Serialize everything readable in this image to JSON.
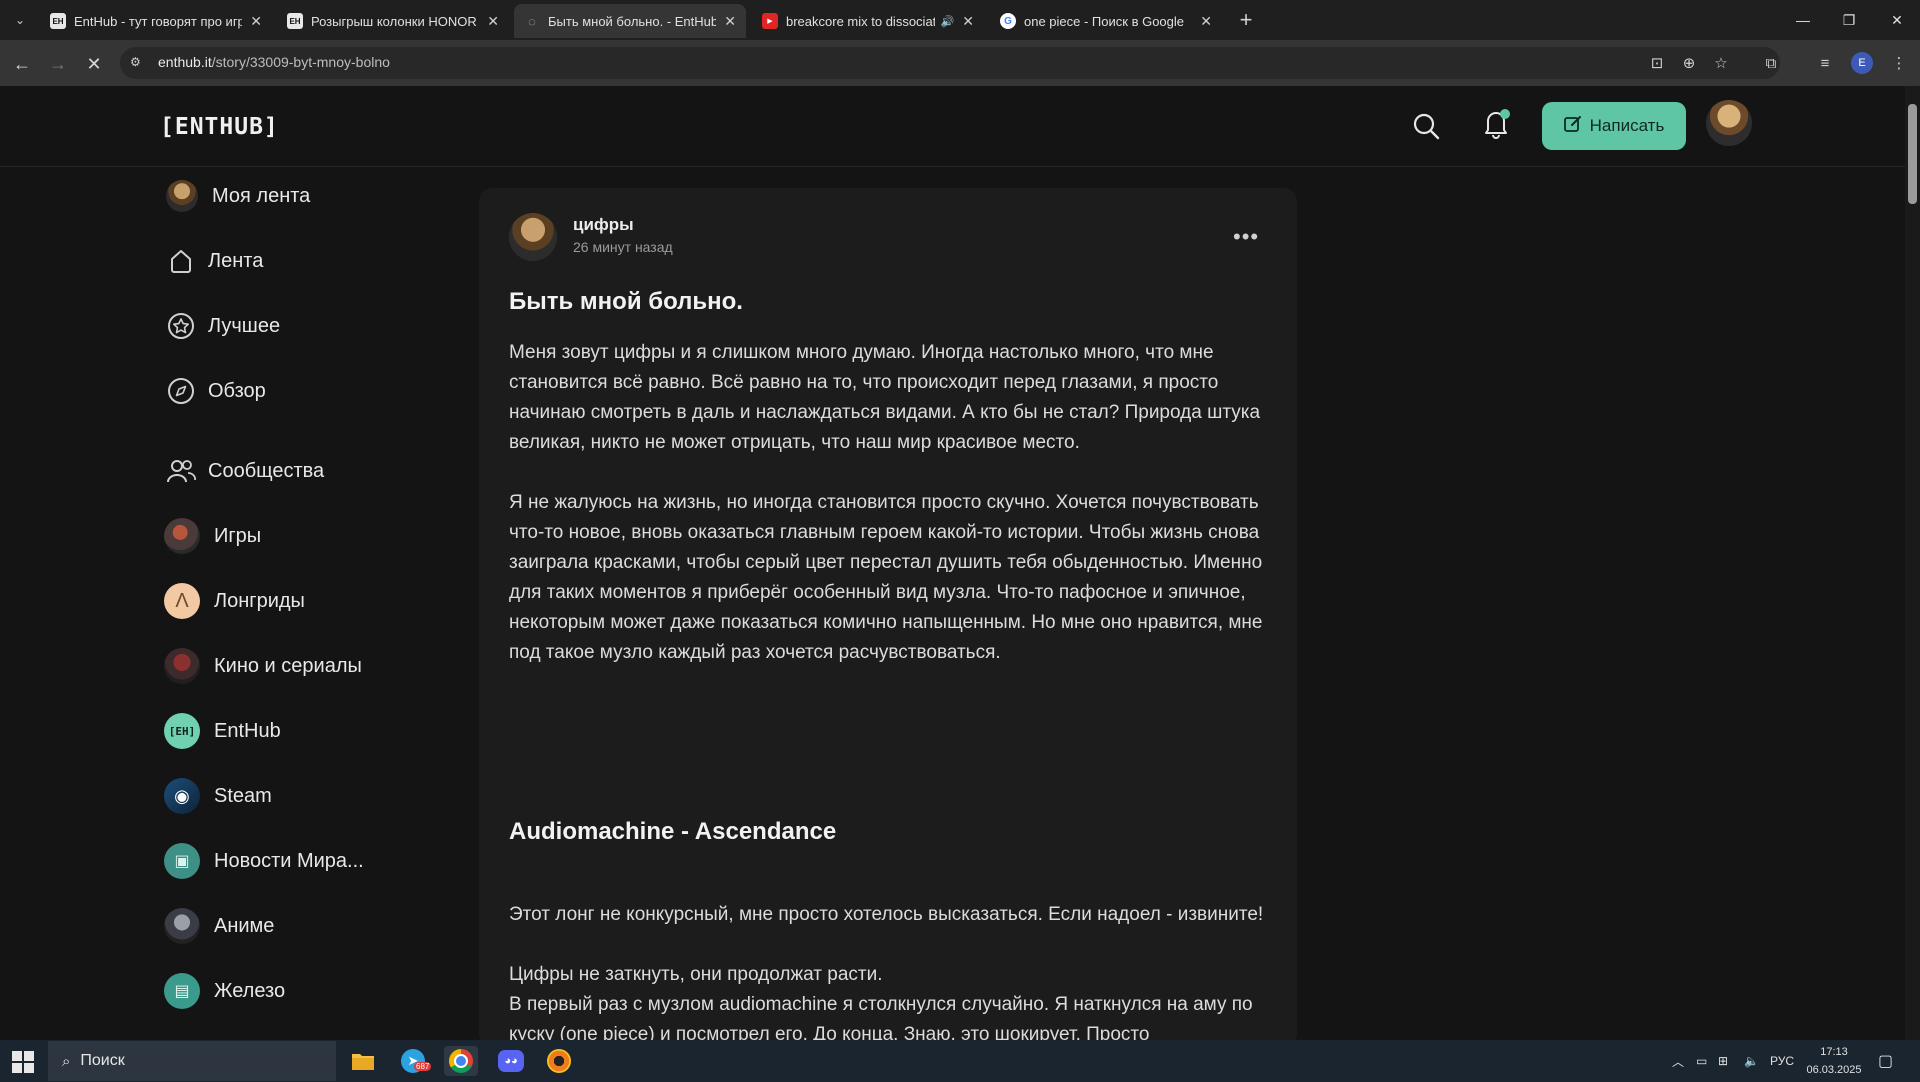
{
  "browser": {
    "tabs": [
      {
        "title": "EntHub - тут говорят про игры",
        "active": false
      },
      {
        "title": "Розыгрыш колонки HONOR от",
        "active": false
      },
      {
        "title": "Быть мной больно. - EntHub",
        "active": true
      },
      {
        "title": "breakcore mix to dissociate",
        "active": false
      },
      {
        "title": "one piece - Поиск в Google",
        "active": false
      }
    ],
    "url_domain": "enthub.it",
    "url_path": "/story/33009-byt-mnoy-bolno",
    "profile_initial": "E",
    "colors": {
      "accent": "#5ec6a4",
      "tab_active": "#353535"
    }
  },
  "site": {
    "logo": "[ENTHUB]",
    "write_button": "Написать"
  },
  "sidebar": {
    "items": [
      {
        "label": "Моя лента",
        "icon": "avatar"
      },
      {
        "label": "Лента",
        "icon": "home-icon"
      },
      {
        "label": "Лучшее",
        "icon": "star-icon"
      },
      {
        "label": "Обзор",
        "icon": "compass-icon"
      },
      {
        "label": "Сообщества",
        "icon": "people-icon"
      },
      {
        "label": "Игры",
        "icon": "avatar"
      },
      {
        "label": "Лонгриды",
        "icon": "avatar"
      },
      {
        "label": "Кино и сериалы",
        "icon": "avatar"
      },
      {
        "label": "EntHub",
        "icon": "avatar"
      },
      {
        "label": "Steam",
        "icon": "avatar"
      },
      {
        "label": "Новости Мира...",
        "icon": "avatar"
      },
      {
        "label": "Аниме",
        "icon": "avatar"
      },
      {
        "label": "Железо",
        "icon": "avatar"
      }
    ]
  },
  "post": {
    "author": "цифры",
    "time": "26 минут назад",
    "title": "Быть мной больно.",
    "paragraphs": [
      "Меня зовут цифры и я слишком много думаю. Иногда настолько много, что мне становится всё равно. Всё равно на то, что происходит перед глазами, я просто начинаю смотреть в даль и наслаждаться видами. А кто бы не стал? Природа штука великая, никто не может отрицать, что наш мир красивое место.",
      "Я не жалуюсь на жизнь, но иногда становится просто скучно. Хочется почувствовать что-то новое, вновь оказаться главным героем какой-то истории. Чтобы жизнь снова заиграла красками, чтобы серый цвет перестал душить тебя обыденностью. Именно для таких моментов я приберёг особенный вид музла. Что-то пафосное и эпичное, некоторым может даже показаться комично напыщенным. Но мне оно нравится, мне под такое музло каждый раз хочется расчувствоваться."
    ],
    "section_title": "Audiomachine - Ascendance",
    "paragraphs2": [
      "Этот лонг не конкурсный, мне просто хотелось высказаться. Если надоел - извините!",
      "Цифры не заткнуть, они продолжат расти.",
      "В первый раз с музлом audiomachine я столкнулся случайно. Я наткнулся на аму по куску (one piece) и посмотрел его. До конца. Знаю, это шокирует. Просто"
    ]
  },
  "taskbar": {
    "search_placeholder": "Поиск",
    "telegram_badge": "687",
    "language": "РУС",
    "time": "17:13",
    "date": "06.03.2025"
  }
}
